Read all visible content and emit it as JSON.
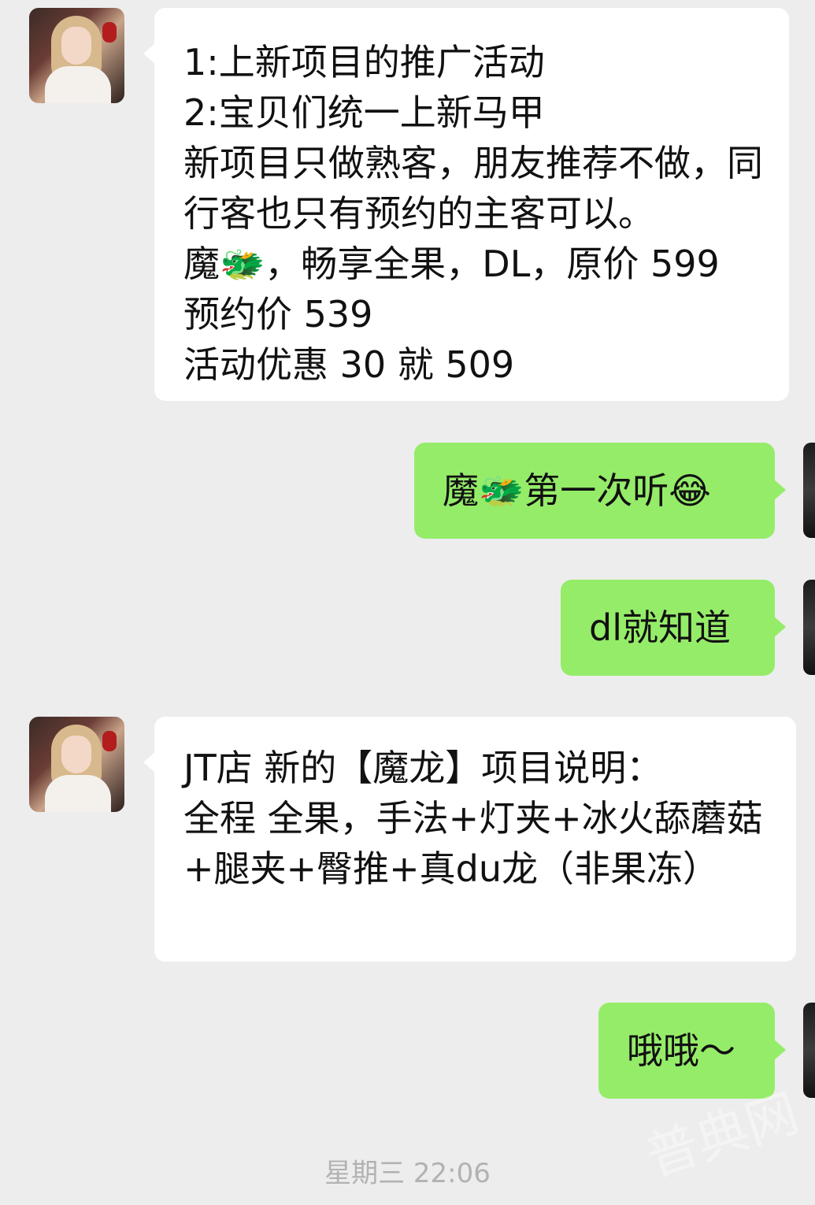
{
  "chat": {
    "messages": [
      {
        "side": "left",
        "text": "1:上新项目的推广活动\n2:宝贝们统一上新马甲\n新项目只做熟客，朋友推荐不做，同行客也只有预约的主客可以。\n魔🐲，畅享全果，DL，原价 599\n预约价 539\n活动优惠 30 就 509"
      },
      {
        "side": "right",
        "text": "魔🐲第一次听😂"
      },
      {
        "side": "right",
        "text": "dl就知道"
      },
      {
        "side": "left",
        "text": "JT店 新的【魔龙】项目说明：\n全程 全果，手法+灯夹+冰火舔蘑菇+腿夹+臀推+真du龙（非果冻）"
      },
      {
        "side": "right",
        "text": "哦哦～"
      }
    ]
  },
  "footer": {
    "timestamp": "星期三 22:06"
  },
  "watermark": {
    "text": "普典网"
  },
  "colors": {
    "background": "#ededed",
    "incoming_bubble": "#ffffff",
    "outgoing_bubble": "#95ec69",
    "timestamp": "#b2b2b2"
  },
  "icons": {
    "contact_avatar": "avatar-icon",
    "self_avatar": "avatar-icon"
  }
}
